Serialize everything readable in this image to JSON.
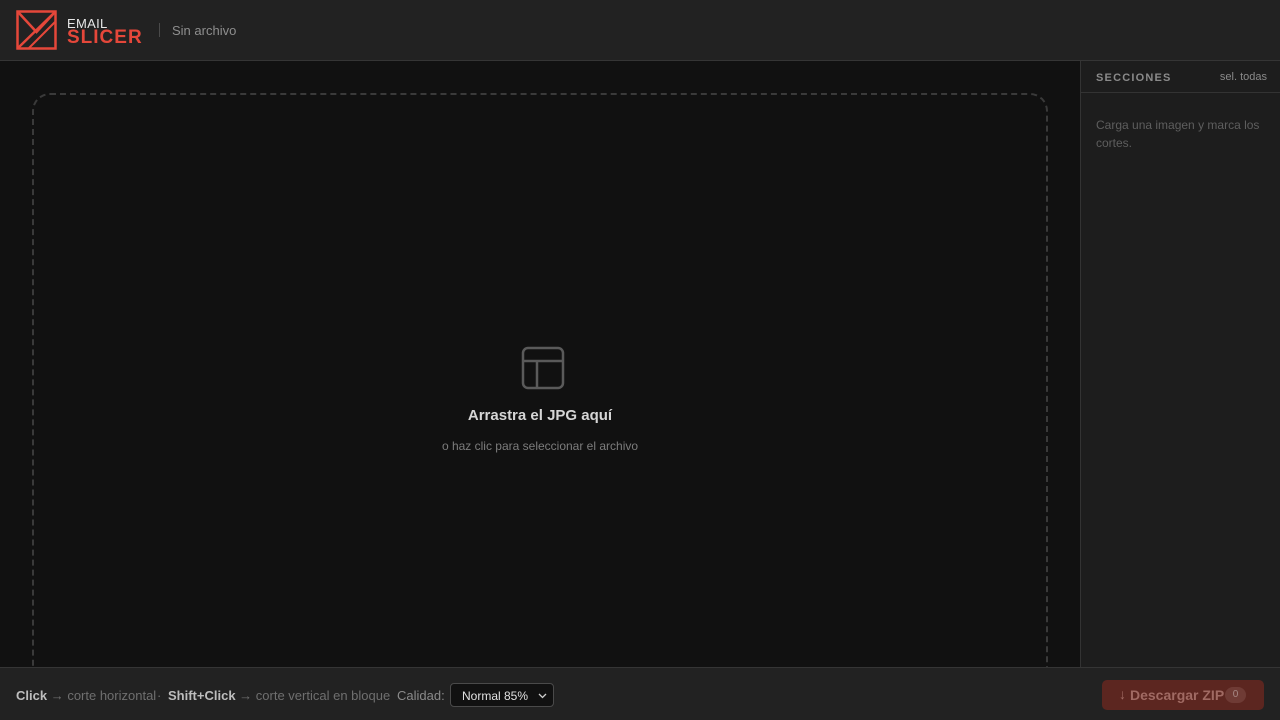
{
  "header": {
    "logo_top": "EMAIL",
    "logo_bottom": "SLICER",
    "file_name": "Sin archivo",
    "brand_color": "#e5473a"
  },
  "dropzone": {
    "icon": "layout-icon",
    "title": "Arrastra el JPG aquí",
    "subtitle": "o haz clic para seleccionar el archivo"
  },
  "sidebar": {
    "title": "SECCIONES",
    "select_all": "sel. todas",
    "empty_text": "Carga una imagen y marca los cortes."
  },
  "footer": {
    "hint_click": "Click",
    "hint_click_action": "→ corte horizontal",
    "hint_sep": "·",
    "hint_shift": "Shift+Click",
    "hint_shift_action": "→ corte vertical en bloque",
    "quality_label": "Calidad:",
    "quality_value": "Normal 85%",
    "download_arrow": "↓",
    "download_label": "Descargar ZIP",
    "download_count": "0"
  }
}
